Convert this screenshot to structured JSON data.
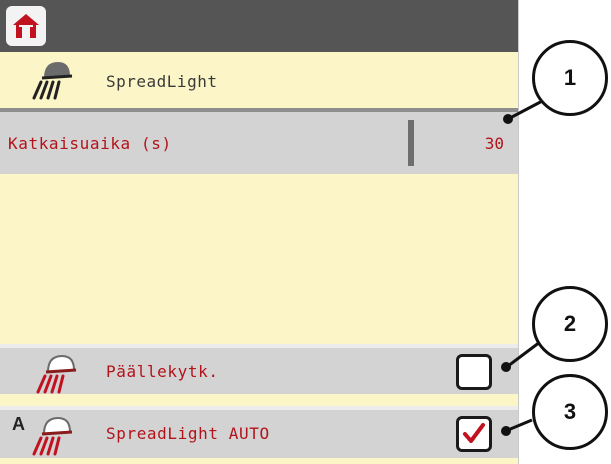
{
  "header": {
    "home_icon": "home-icon"
  },
  "title": {
    "text": "SpreadLight",
    "icon": "spreadlight-lamp-icon"
  },
  "settings": {
    "shutoff_time": {
      "label": "Katkaisuaika (s)",
      "value": "30"
    },
    "main_switch": {
      "label": "Päällekytk.",
      "icon": "spreadlight-lamp-icon",
      "checked": false
    },
    "auto": {
      "label": "SpreadLight AUTO",
      "icon": "spreadlight-auto-icon",
      "checked": true
    }
  },
  "callouts": [
    "1",
    "2",
    "3"
  ],
  "colors": {
    "background": "#fbf5c7",
    "row": "#d3d3d3",
    "topbar": "#555555",
    "label_red": "#b3131a",
    "home_red": "#c1121f"
  }
}
